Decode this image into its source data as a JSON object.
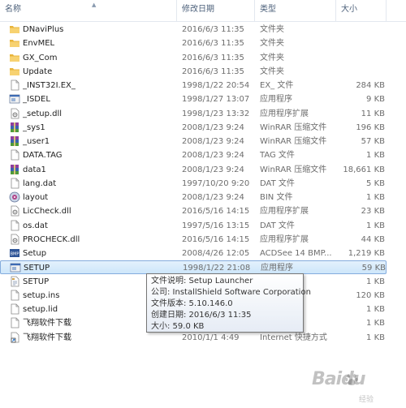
{
  "columns": {
    "name": "名称",
    "date": "修改日期",
    "type": "类型",
    "size": "大小"
  },
  "rows": [
    {
      "icon": "folder-icon",
      "name": "DNaviPlus",
      "date": "2016/6/3 11:35",
      "type": "文件夹",
      "size": ""
    },
    {
      "icon": "folder-icon",
      "name": "EnvMEL",
      "date": "2016/6/3 11:35",
      "type": "文件夹",
      "size": ""
    },
    {
      "icon": "folder-icon",
      "name": "GX_Com",
      "date": "2016/6/3 11:35",
      "type": "文件夹",
      "size": ""
    },
    {
      "icon": "folder-icon",
      "name": "Update",
      "date": "2016/6/3 11:35",
      "type": "文件夹",
      "size": ""
    },
    {
      "icon": "file-icon",
      "name": "_INST32I.EX_",
      "date": "1998/1/22 20:54",
      "type": "EX_ 文件",
      "size": "284 KB"
    },
    {
      "icon": "exe-icon",
      "name": "_ISDEL",
      "date": "1998/1/27 13:07",
      "type": "应用程序",
      "size": "9 KB"
    },
    {
      "icon": "dll-icon",
      "name": "_setup.dll",
      "date": "1998/1/23 13:32",
      "type": "应用程序扩展",
      "size": "11 KB"
    },
    {
      "icon": "winrar-icon",
      "name": "_sys1",
      "date": "2008/1/23 9:24",
      "type": "WinRAR 压缩文件",
      "size": "196 KB"
    },
    {
      "icon": "winrar-icon",
      "name": "_user1",
      "date": "2008/1/23 9:24",
      "type": "WinRAR 压缩文件",
      "size": "57 KB"
    },
    {
      "icon": "file-icon",
      "name": "DATA.TAG",
      "date": "2008/1/23 9:24",
      "type": "TAG 文件",
      "size": "1 KB"
    },
    {
      "icon": "winrar-icon",
      "name": "data1",
      "date": "2008/1/23 9:24",
      "type": "WinRAR 压缩文件",
      "size": "18,661 KB"
    },
    {
      "icon": "file-icon",
      "name": "lang.dat",
      "date": "1997/10/20 9:20",
      "type": "DAT 文件",
      "size": "5 KB"
    },
    {
      "icon": "disc-icon",
      "name": "layout",
      "date": "2008/1/23 9:24",
      "type": "BIN 文件",
      "size": "1 KB"
    },
    {
      "icon": "dll-icon",
      "name": "LicCheck.dll",
      "date": "2016/5/16 14:15",
      "type": "应用程序扩展",
      "size": "23 KB"
    },
    {
      "icon": "file-icon",
      "name": "os.dat",
      "date": "1997/5/16 13:15",
      "type": "DAT 文件",
      "size": "1 KB"
    },
    {
      "icon": "dll-icon",
      "name": "PROCHECK.dll",
      "date": "2016/5/16 14:15",
      "type": "应用程序扩展",
      "size": "44 KB"
    },
    {
      "icon": "bmp-icon",
      "name": "Setup",
      "date": "2008/4/26 12:05",
      "type": "ACDSee 14 BMP...",
      "size": "1,219 KB"
    },
    {
      "icon": "exe-icon",
      "name": "SETUP",
      "date": "1998/1/22 21:08",
      "type": "应用程序",
      "size": "59 KB",
      "selected": true
    },
    {
      "icon": "settings-file-icon",
      "name": "SETUP",
      "date": "",
      "type": "",
      "size": "1 KB"
    },
    {
      "icon": "file-icon",
      "name": "setup.ins",
      "date": "",
      "type": "",
      "size": "120 KB"
    },
    {
      "icon": "file-icon",
      "name": "setup.lid",
      "date": "",
      "type": "",
      "size": "1 KB"
    },
    {
      "icon": "file-icon",
      "name": "飞翔软件下载",
      "date": "",
      "type": "",
      "size": "1 KB"
    },
    {
      "icon": "shortcut-icon",
      "name": "飞翔软件下载",
      "date": "2010/1/1 4:49",
      "type": "Internet 快捷方式",
      "size": "1 KB"
    }
  ],
  "tooltip": {
    "description": "文件说明: Setup Launcher",
    "company": "公司: InstallShield Software Corporation",
    "version": "文件版本: 5.10.146.0",
    "created": "创建日期: 2016/6/3 11:35",
    "size": "大小: 59.0 KB"
  },
  "watermark": {
    "brand": "Baidu",
    "sub": "经验"
  }
}
